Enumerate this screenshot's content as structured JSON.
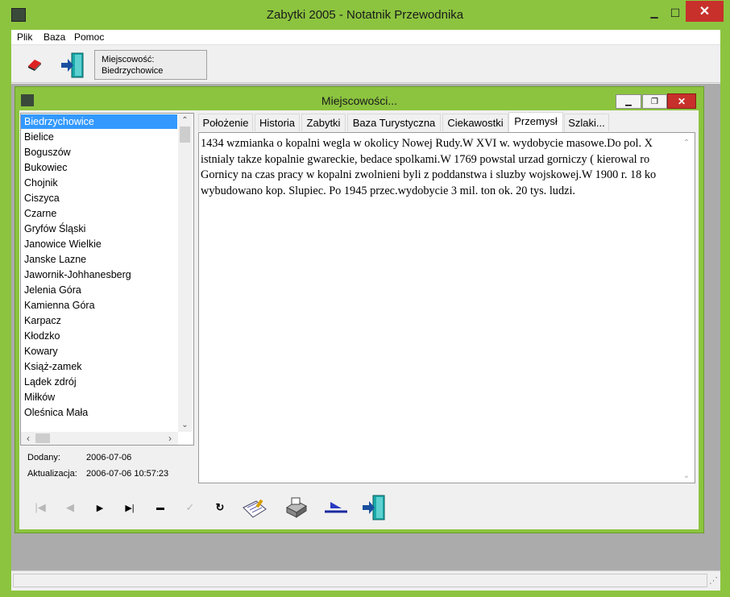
{
  "window": {
    "title": "Zabytki 2005 - Notatnik Przewodnika"
  },
  "menu": {
    "items": [
      "Plik",
      "Baza",
      "Pomoc"
    ]
  },
  "toolbar": {
    "eraser_icon": "eraser-icon",
    "exit_icon": "exit-door-icon",
    "location_label": "Miejscowość:",
    "location_value": "Biedrzychowice"
  },
  "child": {
    "title": "Miejscowości...",
    "cities": [
      "Biedrzychowice",
      "Bielice",
      "Boguszów",
      "Bukowiec",
      "Chojnik",
      "Ciszyca",
      "Czarne",
      "Gryfów Śląski",
      "Janowice Wielkie",
      "Janske Lazne",
      "Jawornik-Johhanesberg",
      "Jelenia Góra",
      "Kamienna Góra",
      "Karpacz",
      "Kłodzko",
      "Kowary",
      "Książ-zamek",
      "Lądek zdrój",
      "Miłków",
      "Oleśnica Mała"
    ],
    "selected_city": "Biedrzychowice",
    "added_label": "Dodany:",
    "added_value": "2006-07-06",
    "updated_label": "Aktualizacja:",
    "updated_value": "2006-07-06 10:57:23",
    "tabs": [
      "Położenie",
      "Historia",
      "Zabytki",
      "Baza Turystyczna",
      "Ciekawostki",
      "Przemysł",
      "Szlaki..."
    ],
    "active_tab": "Przemysł",
    "text_lines": [
      "1434 wzmianka o kopalni wegla w okolicy Nowej Rudy.W XVI w. wydobycie masowe.Do pol. X",
      "istnialy takze kopalnie gwareckie, bedace spolkami.W 1769 powstal urzad gorniczy (   kierowal ro",
      "Gornicy na czas pracy w kopalni zwolnieni byli z poddanstwa i sluzby wojskowej.W 1900 r. 18 ko",
      "wybudowano kop. Slupiec. Po 1945 przec.wydobycie 3 mil. ton ok. 20 tys. ludzi."
    ]
  },
  "nav": {
    "first": "|◀",
    "prev": "◀",
    "next": "▶",
    "last": "▶|",
    "delete": "▬",
    "post": "✓",
    "refresh": "↻"
  }
}
